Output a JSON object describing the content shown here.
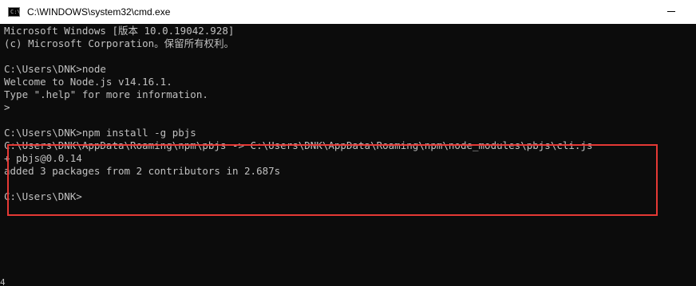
{
  "window": {
    "title": "C:\\WINDOWS\\system32\\cmd.exe",
    "icon_glyph": "C:\\"
  },
  "console": {
    "lines": [
      "Microsoft Windows [版本 10.0.19042.928]",
      "(c) Microsoft Corporation。保留所有权利。",
      "",
      "C:\\Users\\DNK>node",
      "Welcome to Node.js v14.16.1.",
      "Type \".help\" for more information.",
      ">",
      "",
      "C:\\Users\\DNK>npm install -g pbjs",
      "C:\\Users\\DNK\\AppData\\Roaming\\npm\\pbjs -> C:\\Users\\DNK\\AppData\\Roaming\\npm\\node_modules\\pbjs\\cli.js",
      "+ pbjs@0.0.14",
      "added 3 packages from 2 contributors in 2.687s",
      "",
      "C:\\Users\\DNK>"
    ],
    "stray_char": "4"
  },
  "colors": {
    "console_bg": "#0c0c0c",
    "console_text": "#c0c0c0",
    "titlebar_bg": "#ffffff",
    "highlight_border": "#e53935"
  }
}
